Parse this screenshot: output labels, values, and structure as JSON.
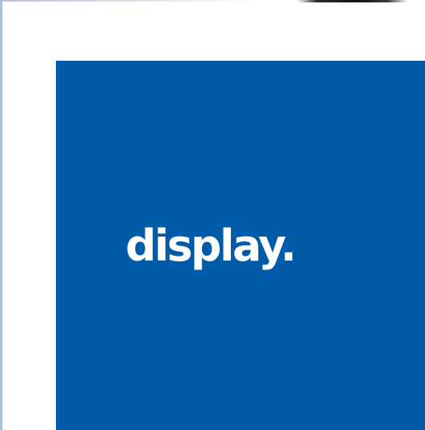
{
  "brand": {
    "wordmark": "display.",
    "background_color": "#005ba8",
    "text_color": "#ffffff"
  },
  "page": {
    "background_color": "#ffffff",
    "left_edge_color": "#aac0df"
  }
}
